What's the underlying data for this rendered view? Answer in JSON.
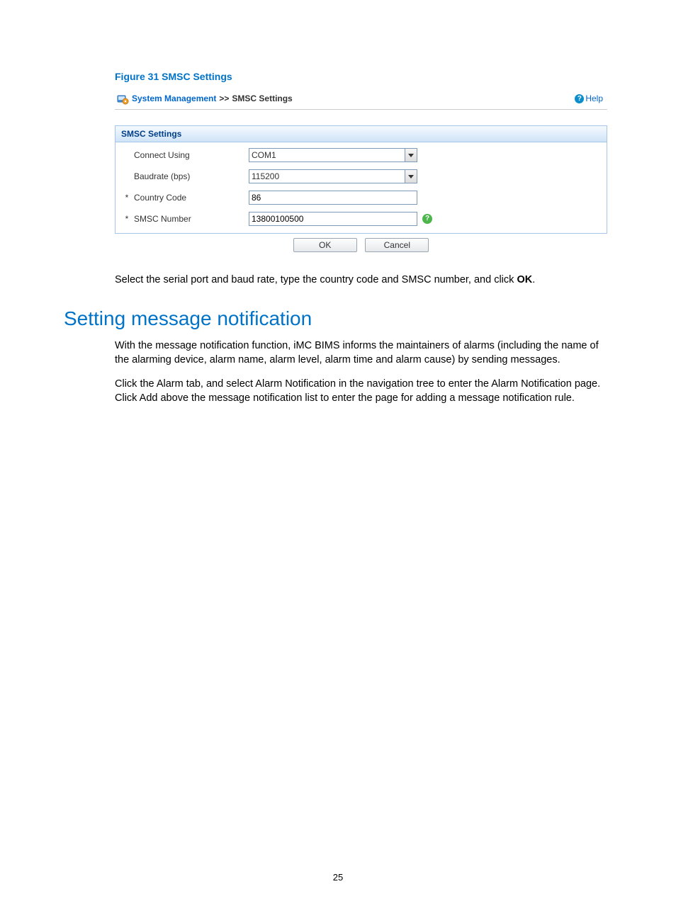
{
  "figure_caption": "Figure 31 SMSC Settings",
  "breadcrumb": {
    "root": "System Management",
    "sep": ">>",
    "current": "SMSC Settings"
  },
  "help_label": "Help",
  "panel_title": "SMSC Settings",
  "fields": {
    "connect_using": {
      "label": "Connect Using",
      "value": "COM1"
    },
    "baudrate": {
      "label": "Baudrate (bps)",
      "value": "115200"
    },
    "country_code": {
      "label": "Country Code",
      "value": "86",
      "required": "*"
    },
    "smsc_number": {
      "label": "SMSC Number",
      "value": "13800100500",
      "required": "*"
    }
  },
  "buttons": {
    "ok": "OK",
    "cancel": "Cancel"
  },
  "instr": {
    "pre": "Select the serial port and baud rate, type the country code and SMSC number, and click ",
    "ok_bold": "OK",
    "post": "."
  },
  "section_heading": "Setting message notification",
  "para1": "With the message notification function, iMC BIMS informs the maintainers of alarms (including the name of the alarming device, alarm name, alarm level, alarm time and alarm cause) by sending messages.",
  "para2": {
    "s1": "Click the ",
    "b1": "Alarm",
    "s2": " tab, and select ",
    "b2": "Alarm Notification",
    "s3": " in the navigation tree to enter the ",
    "b3": "Alarm Notification",
    "s4": " page. Click ",
    "b4": "Add",
    "s5": " above the message notification list to enter the page for adding a message notification rule."
  },
  "page_number": "25"
}
